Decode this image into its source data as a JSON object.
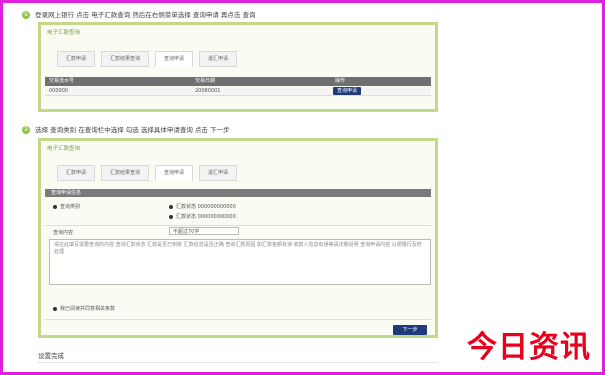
{
  "step1": {
    "number": "①",
    "text": "登录网上银行 点击 电子汇款查询 然后在右侧菜单选择 查询申请 再点击 查询"
  },
  "panel1": {
    "title": "电子汇款查询",
    "tabs": [
      "汇款申请",
      "汇款结果查询",
      "查询申请",
      "退汇申请"
    ],
    "table_header": [
      "交易流水号",
      "交易日期",
      "操作"
    ],
    "row": [
      "000000",
      "20080001",
      "查询申请"
    ]
  },
  "step2": {
    "number": "②",
    "text": "选择 查询类别 在查询栏中选择 勾选 选择具体申请查询 点击 下一步"
  },
  "panel2": {
    "title": "电子汇款查询",
    "tabs": [
      "汇款申请",
      "汇款结果查询",
      "查询申请",
      "退汇申请"
    ],
    "section_title": "查询申请信息",
    "left_label": "查询类别",
    "options": [
      "汇款状态 000000000000",
      "汇款状态 000000000000"
    ],
    "detail_label": "查询内容",
    "small_input": "不超过70字",
    "content_text": "请在此填写需要查询的内容 查询汇款状态 汇款是否已到账 汇款信息是否正确 查询汇款原因 如汇款金额有误 收款人信息有误等请详细说明 查询申请内容 以便银行及时处理",
    "agree_text": "我已阅读并同意相关条款",
    "next_button": "下一步"
  },
  "footer_text": "设置完成",
  "watermark": "今日资讯",
  "colors": {
    "frame": "#e020e0",
    "panel_border": "#c4d88a",
    "header_gray": "#6f6f6f",
    "button_blue": "#1f3a7a",
    "watermark_red": "#e8001c"
  }
}
